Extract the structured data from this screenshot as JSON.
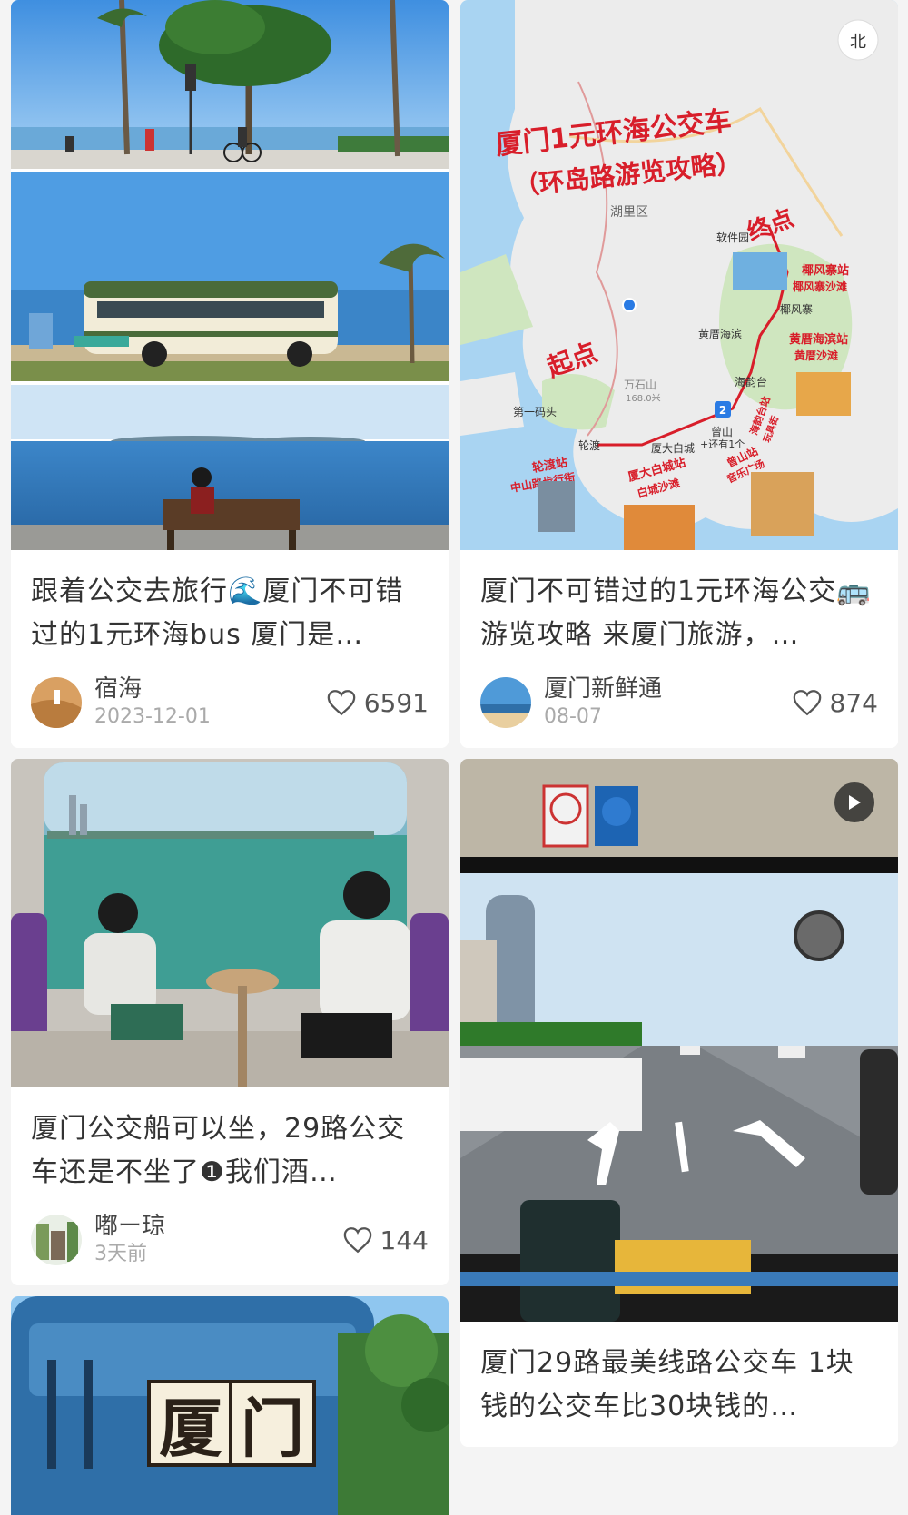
{
  "feed": {
    "cards": [
      {
        "title": "跟着公交去旅行🌊厦门不可错过的1元环海bus 厦门是…",
        "author": "宿海",
        "date": "2023-12-01",
        "likes": "6591"
      },
      {
        "title": "厦门不可错过的1元环海公交🚌游览攻略 来厦门旅游，…",
        "author": "厦门新鲜通",
        "date": "08-07",
        "likes": "874",
        "map": {
          "title_line1": "厦门1元环海公交车",
          "title_line2": "（环岛路游览攻略）",
          "compass": "北",
          "start": "起点",
          "end": "终点",
          "district": "湖里区",
          "stops": [
            "软件园",
            "椰风寨",
            "黄厝海滨",
            "海韵台",
            "曾山",
            "厦大白城",
            "轮渡",
            "第一码头"
          ],
          "mountain": "万石山",
          "mountain_height": "168.0米",
          "more_note": "+还有1个",
          "stop_badge": "2",
          "highlights": [
            {
              "name": "轮渡站",
              "sub": "中山路步行街"
            },
            {
              "name": "厦大白城站",
              "sub": "白城沙滩"
            },
            {
              "name": "曾山站",
              "sub": "音乐广场"
            },
            {
              "name": "海韵台站",
              "sub": "玩具街"
            },
            {
              "name": "黄厝海滨站",
              "sub": "黄厝沙滩"
            },
            {
              "name": "椰风寨站",
              "sub": "椰风寨沙滩"
            }
          ]
        }
      },
      {
        "title": "厦门公交船可以坐，29路公交车还是不坐了❶我们酒…",
        "author": "嘟ー琼",
        "date": "3天前",
        "likes": "144"
      },
      {
        "title": "厦门29路最美线路公交车 1块钱的公交车比30块钱的…",
        "video": true
      },
      {
        "cover_text": [
          "厦",
          "门"
        ]
      }
    ]
  },
  "colors": {
    "sky": "#5aa9e6",
    "sea": "#2f79b8",
    "map_red": "#d81e2a",
    "bus_green": "#4a6b3a"
  },
  "icons": {
    "like": "heart-outline-icon",
    "play": "play-icon",
    "compass": "compass-icon"
  }
}
